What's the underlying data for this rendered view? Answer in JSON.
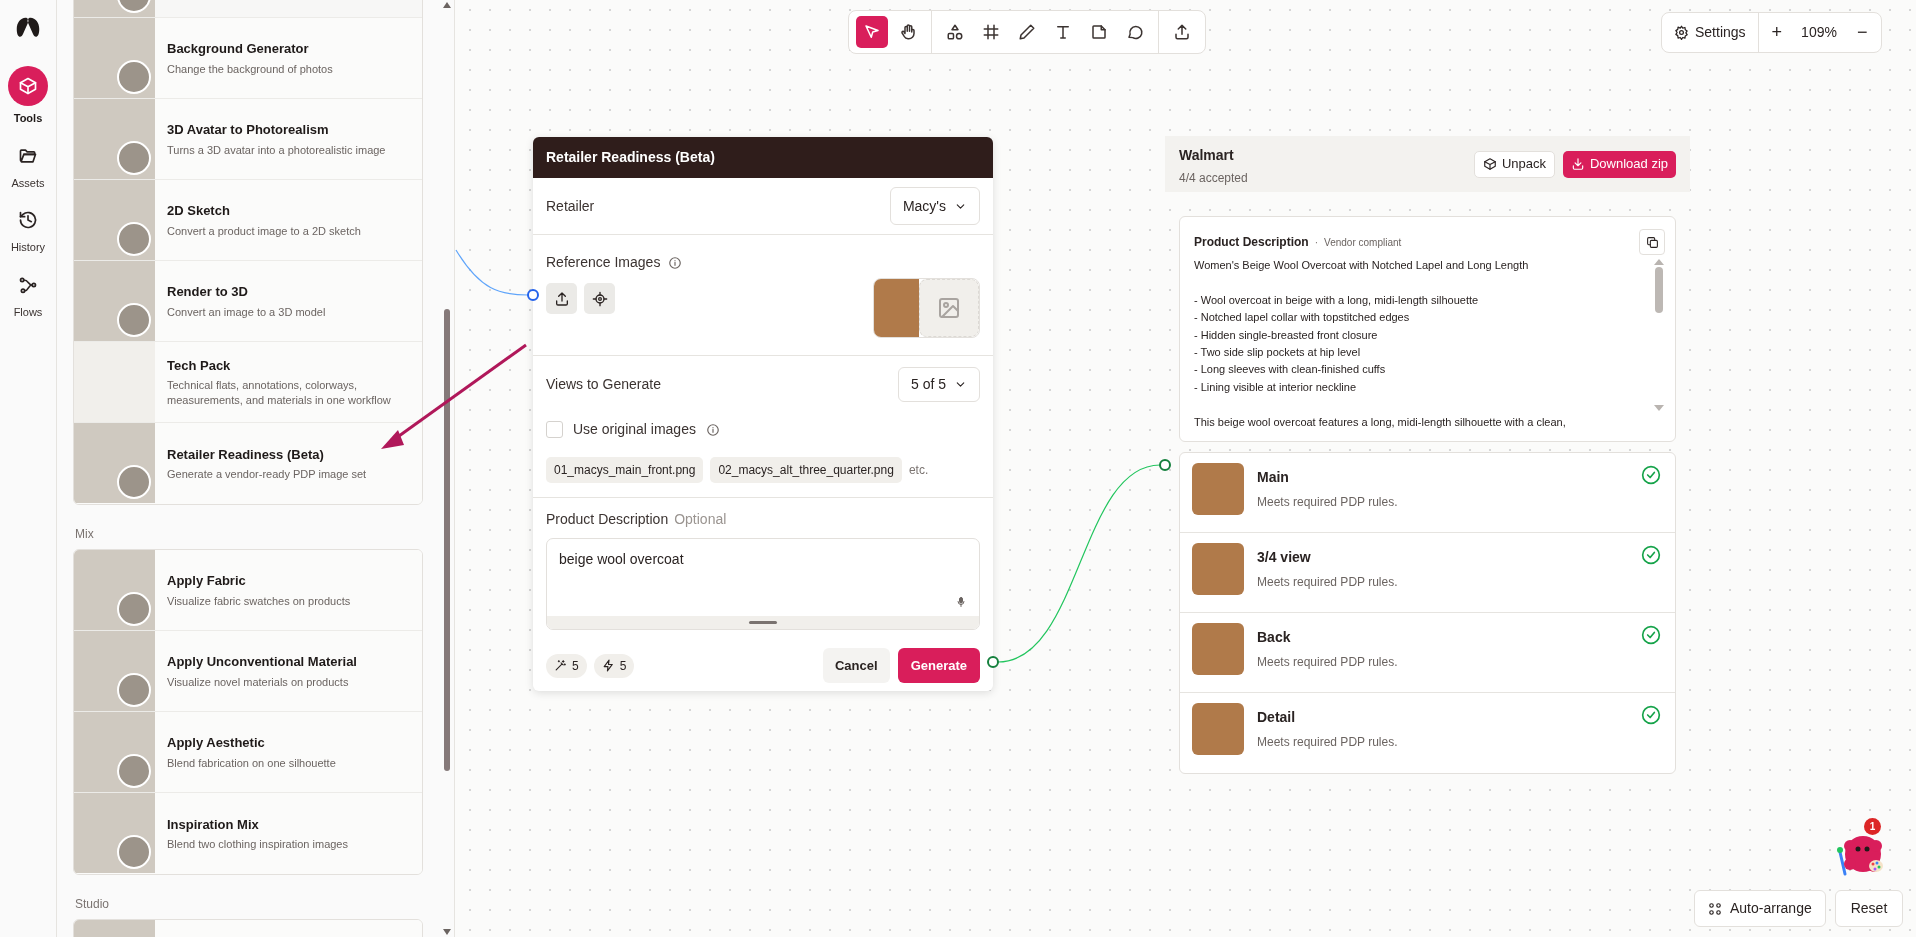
{
  "rail": {
    "items": [
      {
        "kind": "tools",
        "label": "Tools",
        "selected": true
      },
      {
        "kind": "assets",
        "label": "Assets",
        "selected": false
      },
      {
        "kind": "history",
        "label": "History",
        "selected": false
      },
      {
        "kind": "flows",
        "label": "Flows",
        "selected": false
      }
    ]
  },
  "tool_panel": {
    "sections": [
      {
        "cards": [
          {
            "title": "Background Generator",
            "description": "Change the background of photos",
            "kind": "photo"
          },
          {
            "title": "3D Avatar to Photorealism",
            "description": "Turns a 3D avatar into a photorealistic image",
            "kind": "photo"
          },
          {
            "title": "2D Sketch",
            "description": "Convert a product image to a 2D sketch",
            "kind": "photo"
          },
          {
            "title": "Render to 3D",
            "description": "Convert an image to a 3D model",
            "kind": "photo"
          },
          {
            "title": "Tech Pack",
            "description": "Technical flats, annotations, colorways, measurements, and materials in one workflow",
            "kind": "blank"
          },
          {
            "title": "Retailer Readiness (Beta)",
            "description": "Generate a vendor-ready PDP image set",
            "kind": "photo"
          }
        ]
      },
      {
        "title": "Mix",
        "cards": [
          {
            "title": "Apply Fabric",
            "description": "Visualize fabric swatches on products",
            "kind": "photo"
          },
          {
            "title": "Apply Unconventional Material",
            "description": "Visualize novel materials on products",
            "kind": "photo"
          },
          {
            "title": "Apply Aesthetic",
            "description": "Blend fabrication on one silhouette",
            "kind": "photo"
          },
          {
            "title": "Inspiration Mix",
            "description": "Blend two clothing inspiration images",
            "kind": "photo"
          }
        ]
      },
      {
        "title": "Studio"
      }
    ]
  },
  "toolbar": {
    "groups": [
      [
        {
          "kind": "pointer",
          "selected": true
        },
        {
          "kind": "hand",
          "selected": false
        }
      ],
      [
        {
          "kind": "shapes",
          "selected": false
        },
        {
          "kind": "frame",
          "selected": false
        },
        {
          "kind": "pencil",
          "selected": false
        },
        {
          "kind": "text",
          "selected": false
        },
        {
          "kind": "note",
          "selected": false
        },
        {
          "kind": "comment",
          "selected": false
        }
      ],
      [
        {
          "kind": "export",
          "selected": false
        }
      ]
    ]
  },
  "view_controls": {
    "settings": "Settings",
    "zoom_in": "+",
    "zoom": "109%",
    "zoom_out": "−"
  },
  "tool_dialog": {
    "title": "Retailer Readiness (Beta)",
    "retailer": {
      "label": "Retailer",
      "value": "Macy's"
    },
    "reference_images": {
      "label": "Reference Images"
    },
    "views": {
      "label": "Views to Generate",
      "value": "5 of 5"
    },
    "use_original_images": {
      "label": "Use original images",
      "checked": false
    },
    "files": [
      "01_macys_main_front.png",
      "02_macys_alt_three_quarter.png"
    ],
    "files_more": "etc.",
    "description": {
      "label": "Product Description",
      "hint": "Optional",
      "value": "beige wool overcoat"
    },
    "credits": [
      {
        "kind": "wand",
        "value": "5"
      },
      {
        "kind": "bolt",
        "value": "5"
      }
    ],
    "cancel": "Cancel",
    "generate": "Generate"
  },
  "result": {
    "title": "Walmart",
    "subtitle": "4/4 accepted",
    "buttons": [
      {
        "kind": "secondary",
        "label": "Unpack"
      },
      {
        "kind": "primary",
        "label": "Download zip"
      }
    ],
    "description": {
      "title": "Product Description",
      "separator": "·",
      "badge": "Vendor compliant",
      "text": "Women's Beige Wool Overcoat with Notched Lapel and Long Length\n\n- Wool overcoat in beige with a long, midi-length silhouette\n- Notched lapel collar with topstitched edges\n- Hidden single-breasted front closure\n- Two side slip pockets at hip level\n- Long sleeves with clean-finished cuffs\n- Lining visible at interior neckline\n\nThis beige wool overcoat features a long, midi-length silhouette with a clean,"
    },
    "views": [
      {
        "name": "Main",
        "status": "Meets required PDP rules.",
        "accepted": true
      },
      {
        "name": "3/4 view",
        "status": "Meets required PDP rules.",
        "accepted": true
      },
      {
        "name": "Back",
        "status": "Meets required PDP rules.",
        "accepted": true
      },
      {
        "name": "Detail",
        "status": "Meets required PDP rules.",
        "accepted": true
      }
    ]
  },
  "assistant": {
    "notifications": "1"
  },
  "footer_buttons": {
    "auto_arrange": "Auto-arrange",
    "reset": "Reset"
  }
}
